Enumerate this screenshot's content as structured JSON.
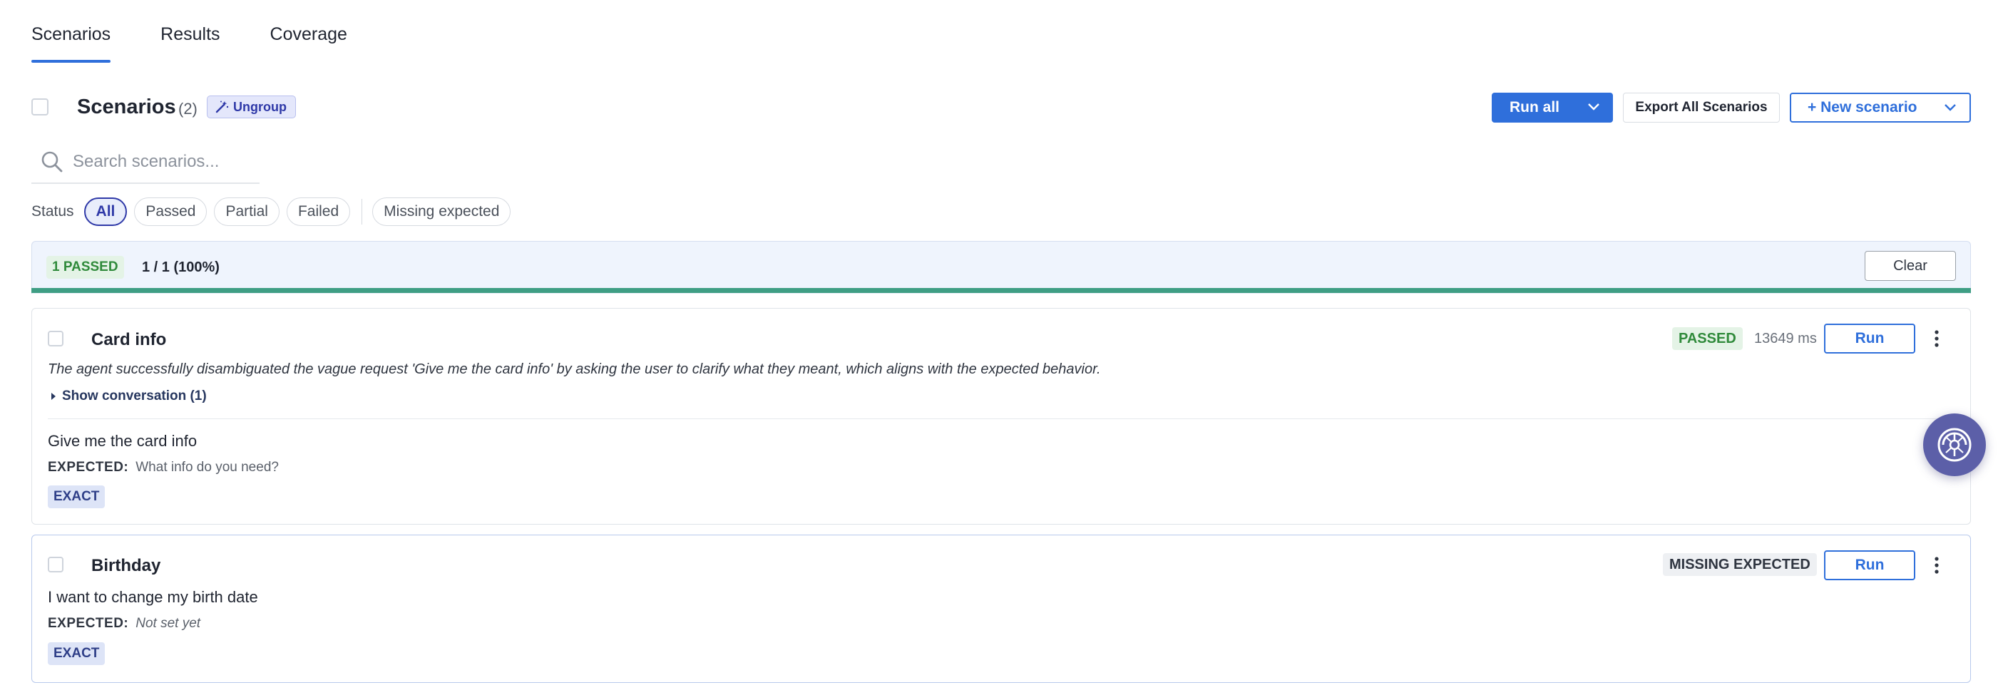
{
  "tabs": [
    {
      "label": "Scenarios",
      "active": true
    },
    {
      "label": "Results",
      "active": false
    },
    {
      "label": "Coverage",
      "active": false
    }
  ],
  "header": {
    "title": "Scenarios",
    "count": "(2)",
    "ungroup_label": "Ungroup",
    "run_all_label": "Run all",
    "export_label": "Export All Scenarios",
    "new_scenario_label": "+ New scenario"
  },
  "search": {
    "placeholder": "Search scenarios...",
    "value": ""
  },
  "filters": {
    "label": "Status",
    "options": [
      "All",
      "Passed",
      "Partial",
      "Failed"
    ],
    "selected": "All",
    "extra": "Missing expected"
  },
  "summary": {
    "passed_badge": "1 PASSED",
    "ratio": "1 / 1 (100%)",
    "clear_label": "Clear",
    "progress_fraction": 1.0,
    "progress_color": "#3f9e84"
  },
  "scenarios": [
    {
      "title": "Card info",
      "status": "PASSED",
      "duration": "13649 ms",
      "run_label": "Run",
      "result_summary": "The agent successfully disambiguated the vague request 'Give me the card info' by asking the user to clarify what they meant, which aligns with the expected behavior.",
      "show_conversation": "Show conversation (1)",
      "prompt": "Give me the card info",
      "expected_label": "EXPECTED:",
      "expected_value": "What info do you need?",
      "match_type": "EXACT"
    },
    {
      "title": "Birthday",
      "status": "MISSING EXPECTED",
      "run_label": "Run",
      "prompt": "I want to change my birth date",
      "expected_label": "EXPECTED:",
      "expected_value": "Not set yet",
      "match_type": "EXACT"
    }
  ],
  "colors": {
    "accent": "#2f6fdb",
    "passed": "#2f8a3a",
    "progress": "#3f9e84",
    "fab": "#5c5fa8"
  },
  "icons": {
    "ungroup": "magic-wand-icon",
    "search": "search-icon",
    "dropdown": "chevron-down-icon",
    "menu": "kebab-menu-icon",
    "expand": "caret-right-icon",
    "assistant": "assistant-logo-icon"
  }
}
